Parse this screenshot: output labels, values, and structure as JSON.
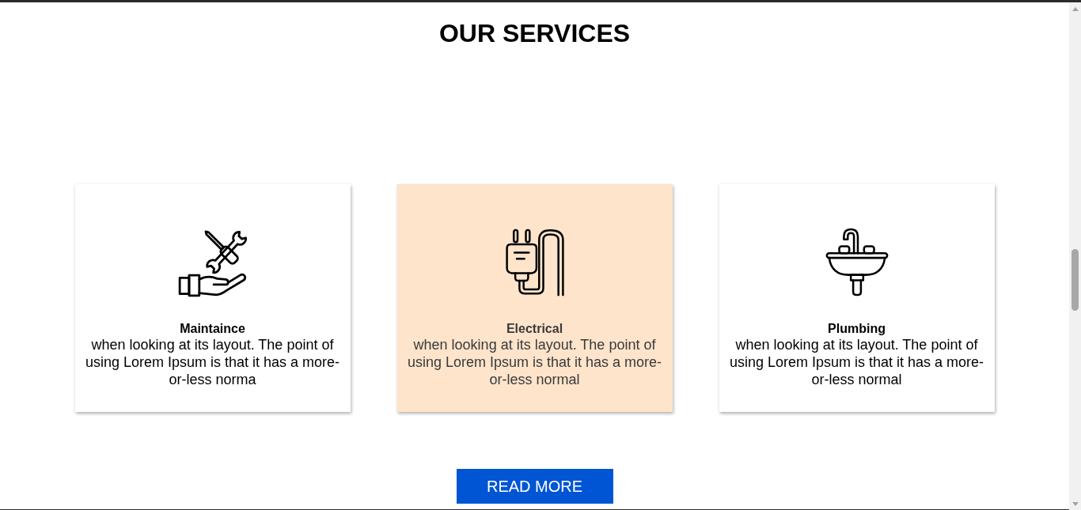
{
  "heading": "OUR SERVICES",
  "cards": [
    {
      "title": "Maintaince",
      "text": "when looking at its layout. The point of using Lorem Ipsum is that it has a more-or-less norma",
      "highlighted": false
    },
    {
      "title": "Electrical",
      "text": "when looking at its layout. The point of using Lorem Ipsum is that it has a more-or-less normal",
      "highlighted": true
    },
    {
      "title": "Plumbing",
      "text": "when looking at its layout. The point of using Lorem Ipsum is that it has a more-or-less normal",
      "highlighted": false
    }
  ],
  "button": {
    "label": "READ MORE"
  }
}
